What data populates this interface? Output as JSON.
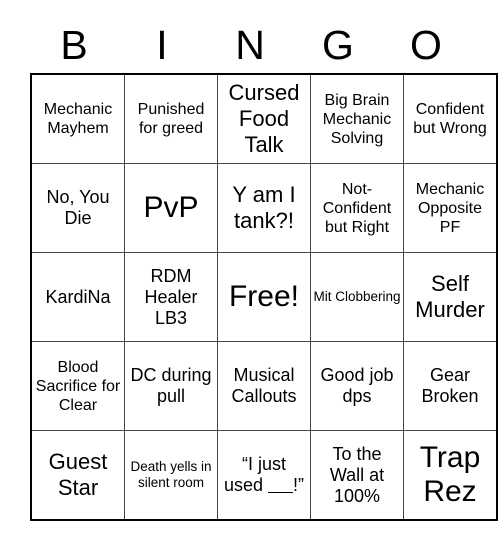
{
  "header": {
    "letters": [
      "B",
      "I",
      "N",
      "G",
      "O"
    ]
  },
  "grid": {
    "rows": [
      [
        {
          "text": "Mechanic Mayhem",
          "size": "fs-sm"
        },
        {
          "text": "Punished for greed",
          "size": "fs-sm"
        },
        {
          "text": "Cursed Food Talk",
          "size": "fs-lg"
        },
        {
          "text": "Big Brain Mechanic Solving",
          "size": "fs-sm"
        },
        {
          "text": "Confident but Wrong",
          "size": "fs-sm"
        }
      ],
      [
        {
          "text": "No, You Die",
          "size": "fs-md"
        },
        {
          "text": "PvP",
          "size": "fs-xl"
        },
        {
          "text": "Y am I tank?!",
          "size": "fs-lg"
        },
        {
          "text": "Not-Confident but Right",
          "size": "fs-sm"
        },
        {
          "text": "Mechanic Opposite PF",
          "size": "fs-sm"
        }
      ],
      [
        {
          "text": "KardiNa",
          "size": "fs-md"
        },
        {
          "text": "RDM Healer LB3",
          "size": "fs-md"
        },
        {
          "text": "Free!",
          "size": "fs-xl"
        },
        {
          "text": "Mit Clobbering",
          "size": "fs-xs"
        },
        {
          "text": "Self Murder",
          "size": "fs-lg"
        }
      ],
      [
        {
          "text": "Blood Sacrifice for Clear",
          "size": "fs-sm"
        },
        {
          "text": "DC during pull",
          "size": "fs-md"
        },
        {
          "text": "Musical Callouts",
          "size": "fs-md"
        },
        {
          "text": "Good job dps",
          "size": "fs-md"
        },
        {
          "text": "Gear Broken",
          "size": "fs-md"
        }
      ],
      [
        {
          "text": "Guest Star",
          "size": "fs-lg"
        },
        {
          "text": "Death yells in silent room",
          "size": "fs-xs"
        },
        {
          "text": "“I just used ____!”",
          "size": "fs-md"
        },
        {
          "text": "To the Wall at 100%",
          "size": "fs-md"
        },
        {
          "text": "Trap Rez",
          "size": "fs-xl"
        }
      ]
    ]
  },
  "colors": {
    "background": "#ffffff",
    "text": "#000000",
    "grid_outer_border": "#000000",
    "grid_inner_border": "#444444"
  }
}
